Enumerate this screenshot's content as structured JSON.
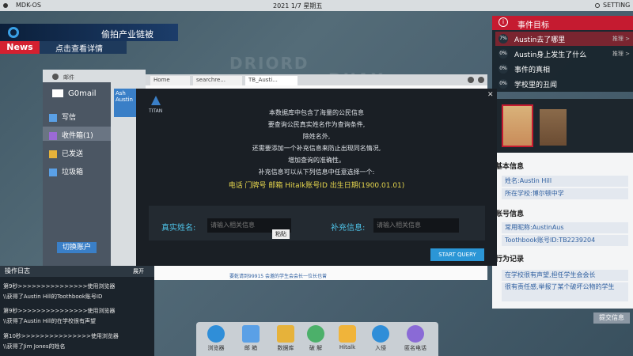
{
  "topbar": {
    "os_name": "MDK-OS",
    "datetime": "2021 1/7 星期五",
    "setting": "SETTING"
  },
  "map_labels": [
    "DRIORD",
    "DUAX"
  ],
  "news": {
    "title": "偷拍产业链被",
    "tag": "News",
    "link": "点击查看详情"
  },
  "events": {
    "title": "事件目标",
    "items": [
      {
        "pct": "7%",
        "label": "Austin去了哪里",
        "tip": "推理 >"
      },
      {
        "pct": "0%",
        "label": "Austin身上发生了什么",
        "tip": "推理 >"
      },
      {
        "pct": "0%",
        "label": "事件的真相",
        "tip": ""
      },
      {
        "pct": "0%",
        "label": "学校里的丑闻",
        "tip": ""
      }
    ]
  },
  "profile": {
    "basic_title": "基本信息",
    "basic": [
      "姓名:Austin Hill",
      "所在学校:博尔顿中学"
    ],
    "account_title": "账号信息",
    "account": [
      "常用昵称:AustinAus",
      "Toothbook账号ID:TB2239204"
    ],
    "behavior_title": "行为记录",
    "behavior": [
      "在学校很有声望,担任学生会会长",
      "很有责任感,举报了某个破坏公物的学生"
    ],
    "submit": "提交信息"
  },
  "mail": {
    "user": "邮件",
    "title": "G0mail",
    "items": [
      "写信",
      "收件箱(1)",
      "已发送",
      "垃圾箱"
    ],
    "switch": "切换账户",
    "preview": "Ash Austin"
  },
  "browser": {
    "tabs": [
      "Home",
      "searchre...",
      "TB_Austi..."
    ],
    "bottom": "要乾请到99915 会邀的学生会会长一位长也曾"
  },
  "titan": {
    "logo": "TITAN",
    "lines": [
      "本数据库中包含了海量的公民信息",
      "要查询公民真实姓名作为查询条件,",
      "除姓名外,",
      "还需要添加一个补充信息来防止出现同名情况,",
      "增加查询的准确性。",
      "补充信息可以从下列信息中任意选择一个:"
    ],
    "options": "电话  门牌号  邮箱  Hitalk账号ID  出生日期(1900.01.01)",
    "name_label": "真实姓名:",
    "name_placeholder": "请输入相关信息",
    "extra_label": "补充信息:",
    "extra_placeholder": "请输入相关信息",
    "paste": "粘贴",
    "start": "START QUERY"
  },
  "log": {
    "title": "操作日志",
    "expand": "展开",
    "lines": [
      "第9秒>>>>>>>>>>>>>>>使用浏览器",
      "\\\\获得了Austin Hill的Toothbook账号ID",
      "第9秒>>>>>>>>>>>>>>>使用浏览器",
      "\\\\获得了Austin Hill的在学校很有声望",
      "第10秒>>>>>>>>>>>>>>>使用浏览器",
      "\\\\获得了Jim Jones的姓名"
    ]
  },
  "dock": [
    "浏览器",
    "邮 箱",
    "数据库",
    "破 解",
    "Hitalk",
    "入侵",
    "匿名电话"
  ],
  "colors": {
    "accent": "#c51b30",
    "query": "#2b96d6",
    "highlight": "#e6d64d"
  }
}
